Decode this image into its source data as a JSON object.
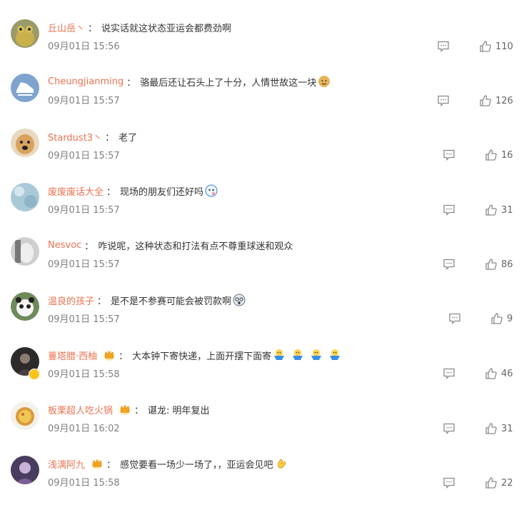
{
  "comments": [
    {
      "user": "丘山岳丶",
      "sep": "：",
      "text": "说实话就这状态亚运会都费劲啊",
      "time": "09月01日 15:56",
      "likes": "110",
      "badge": "",
      "emoji": [],
      "avatar": "frog"
    },
    {
      "user": "Cheungjianming",
      "sep": "：",
      "text": "骆最后还让石头上了十分，人情世故这一块",
      "time": "09月01日 15:57",
      "likes": "126",
      "badge": "",
      "emoji": [
        "doge"
      ],
      "avatar": "shoe"
    },
    {
      "user": "Stardust3丶",
      "sep": "：",
      "text": "老了",
      "time": "09月01日 15:57",
      "likes": "16",
      "badge": "",
      "emoji": [],
      "avatar": "dog"
    },
    {
      "user": "废废废话大全",
      "sep": "：",
      "text": "现场的朋友们还好吗",
      "time": "09月01日 15:57",
      "likes": "31",
      "badge": "",
      "emoji": [
        "face"
      ],
      "avatar": "sky"
    },
    {
      "user": "Nesvoc",
      "sep": "：",
      "text": "咋说呢，这种状态和打法有点不尊重球迷和观众",
      "time": "09月01日 15:57",
      "likes": "86",
      "badge": "",
      "emoji": [],
      "avatar": "hand"
    },
    {
      "user": "温良的孩子",
      "sep": "：",
      "text": "是不是不参赛可能会被罚款啊",
      "time": "09月01日 15:57",
      "likes": "9",
      "badge": "",
      "emoji": [
        "shock"
      ],
      "avatar": "panda"
    },
    {
      "user": "蘴塔腊·西柚",
      "sep": "：",
      "text": "大本钟下寄快递，上面开摆下面寄",
      "time": "09月01日 15:58",
      "likes": "46",
      "badge": "crown",
      "emoji": [
        "bowl",
        "bowl",
        "bowl",
        "bowl"
      ],
      "avatar": "dark"
    },
    {
      "user": "板栗超人吃火锅",
      "sep": "：",
      "text": "谌龙: 明年复出",
      "time": "09月01日 16:02",
      "likes": "31",
      "badge": "crown",
      "emoji": [],
      "avatar": "tart"
    },
    {
      "user": "浅漓阿九",
      "sep": "：",
      "text": "感觉要看一场少一场了，，亚运会见吧",
      "time": "09月01日 15:58",
      "likes": "22",
      "badge": "crown",
      "emoji": [
        "clap"
      ],
      "avatar": "purple"
    }
  ]
}
